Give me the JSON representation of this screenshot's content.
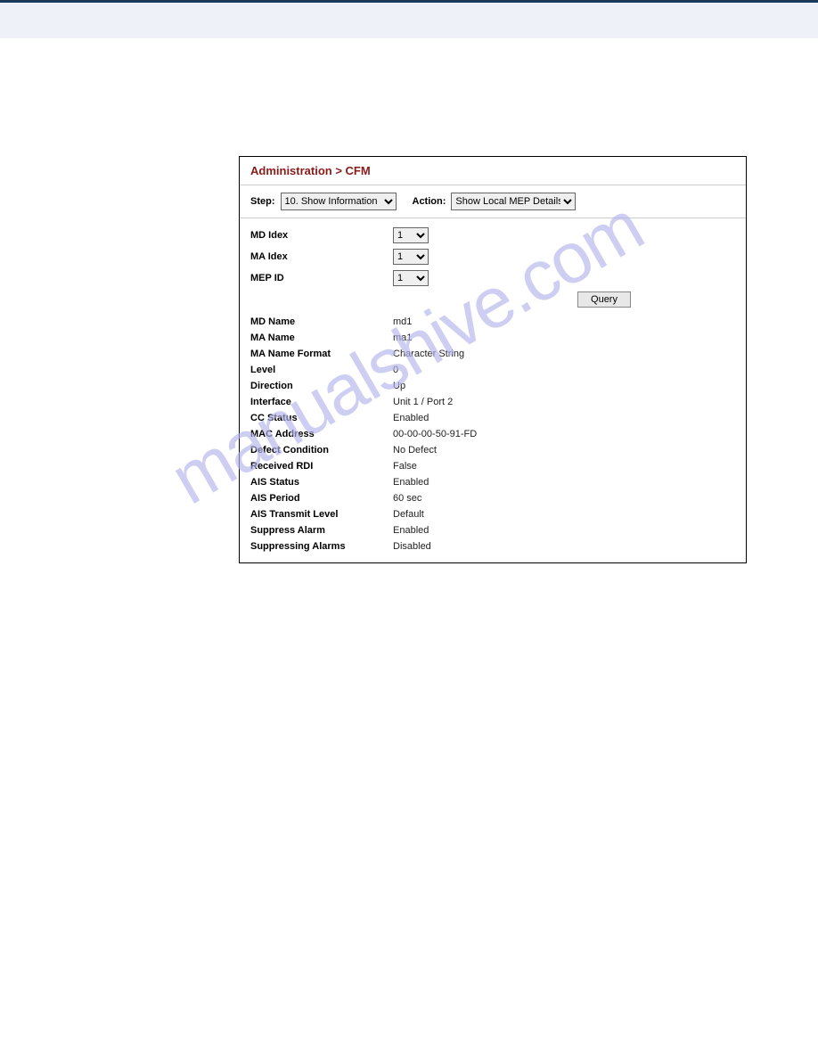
{
  "topbar": {},
  "breadcrumb": "Administration > CFM",
  "controls": {
    "step_label": "Step:",
    "step_value": "10. Show Information",
    "action_label": "Action:",
    "action_value": "Show Local MEP Details"
  },
  "selectors": {
    "md_idex_label": "MD Idex",
    "md_idex_value": "1",
    "ma_idex_label": "MA Idex",
    "ma_idex_value": "1",
    "mep_id_label": "MEP ID",
    "mep_id_value": "1"
  },
  "query_button": "Query",
  "details": [
    {
      "label": "MD Name",
      "value": "md1"
    },
    {
      "label": "MA Name",
      "value": "ma1"
    },
    {
      "label": "MA Name Format",
      "value": "Character String"
    },
    {
      "label": "Level",
      "value": "0"
    },
    {
      "label": "Direction",
      "value": "Up"
    },
    {
      "label": "Interface",
      "value": "Unit 1 / Port 2"
    },
    {
      "label": "CC Status",
      "value": "Enabled"
    },
    {
      "label": "MAC Address",
      "value": "00-00-00-50-91-FD"
    },
    {
      "label": "Defect Condition",
      "value": "No Defect"
    },
    {
      "label": "Received RDI",
      "value": "False"
    },
    {
      "label": "AIS Status",
      "value": "Enabled"
    },
    {
      "label": "AIS Period",
      "value": "60 sec"
    },
    {
      "label": "AIS Transmit Level",
      "value": "Default"
    },
    {
      "label": "Suppress Alarm",
      "value": "Enabled"
    },
    {
      "label": "Suppressing Alarms",
      "value": "Disabled"
    }
  ],
  "watermark": "manualshive.com"
}
